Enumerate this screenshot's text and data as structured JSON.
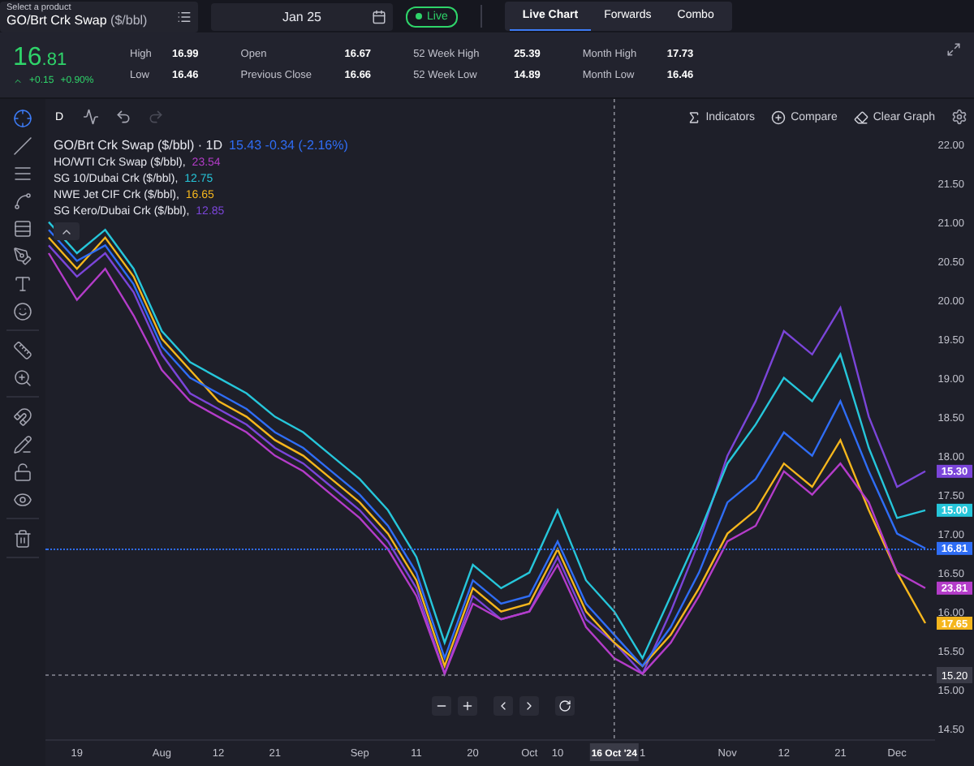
{
  "top_bar": {
    "product": {
      "hint": "Select a product",
      "name": "GO/Brt Crk Swap",
      "unit": "($/bbl)"
    },
    "date": "Jan 25",
    "live": "Live",
    "tabs": [
      {
        "label": "Live Chart",
        "selected": true
      },
      {
        "label": "Forwards",
        "selected": false
      },
      {
        "label": "Combo",
        "selected": false
      }
    ]
  },
  "quote": {
    "price": "16.81",
    "change": "+0.15",
    "change_pct": "+0.90%",
    "stats": [
      [
        {
          "label": "High",
          "value": "16.99"
        },
        {
          "label": "Low",
          "value": "16.46"
        }
      ],
      [
        {
          "label": "Open",
          "value": "16.67"
        },
        {
          "label": "Previous Close",
          "value": "16.66"
        }
      ],
      [
        {
          "label": "52 Week High",
          "value": "25.39"
        },
        {
          "label": "52 Week Low",
          "value": "14.89"
        }
      ],
      [
        {
          "label": "Month High",
          "value": "17.73"
        },
        {
          "label": "Month Low",
          "value": "16.46"
        }
      ]
    ]
  },
  "tool_groups": [
    [
      {
        "kind": "crosshair",
        "selected": true
      },
      {
        "kind": "line",
        "selected": false
      },
      {
        "kind": "channels",
        "selected": false
      },
      {
        "kind": "pattern",
        "selected": false
      },
      {
        "kind": "levels",
        "selected": false
      },
      {
        "kind": "brush",
        "selected": false
      },
      {
        "kind": "text",
        "selected": false
      },
      {
        "kind": "emoji",
        "selected": false
      }
    ],
    [
      {
        "kind": "ruler",
        "selected": false
      },
      {
        "kind": "zoom",
        "selected": false
      }
    ],
    [
      {
        "kind": "magnet",
        "selected": false
      },
      {
        "kind": "lock-drawing",
        "selected": false
      },
      {
        "kind": "unlock",
        "selected": false
      },
      {
        "kind": "hide",
        "selected": false
      }
    ],
    [
      {
        "kind": "delete",
        "selected": false
      }
    ]
  ],
  "chart_toolbar": {
    "interval": "D",
    "history": [
      {
        "kind": "undo",
        "disabled": false
      },
      {
        "kind": "redo",
        "disabled": true
      }
    ],
    "actions": [
      {
        "kind": "indicators",
        "label": "Indicators"
      },
      {
        "kind": "compare",
        "label": "Compare"
      },
      {
        "kind": "clear",
        "label": "Clear Graph"
      }
    ]
  },
  "legend": [
    {
      "suffix": " · 1D",
      "value": "15.43 -0.34 (-2.16%)"
    },
    {
      "suffix": ",",
      "value": "23.54"
    },
    {
      "suffix": ",",
      "value": "12.75"
    },
    {
      "suffix": ",",
      "value": "16.65"
    },
    {
      "suffix": ",",
      "value": "12.85"
    }
  ],
  "price_tags": [
    {
      "text": "15.30",
      "color": "#7b45d9"
    },
    {
      "text": "15.00",
      "color": "#26c6da"
    },
    {
      "text": "16.81",
      "color": "#2f6df5"
    },
    {
      "text": "23.81",
      "color": "#b43cc9"
    },
    {
      "text": "17.65",
      "color": "#f5b61d"
    }
  ],
  "crosshair": {
    "price": "15.20",
    "date": "16 Oct '24"
  },
  "nav_buttons": [
    {
      "kind": "zoom-out"
    },
    {
      "kind": "zoom-in"
    },
    {
      "kind": "left"
    },
    {
      "kind": "right"
    },
    {
      "kind": "reset"
    }
  ],
  "chart_data": {
    "type": "line",
    "categories": [
      null,
      "19",
      null,
      null,
      "Aug",
      null,
      "12",
      null,
      "21",
      null,
      null,
      "Sep",
      null,
      "11",
      null,
      "20",
      null,
      "Oct",
      "10",
      null,
      null,
      "1",
      null,
      null,
      "Nov",
      null,
      "12",
      null,
      "21",
      null,
      "Dec",
      null
    ],
    "ylim": [
      14.35,
      22.58
    ],
    "yticks": [
      {
        "value": 14.5,
        "label": "14.50"
      },
      {
        "value": 15,
        "label": "15.00"
      },
      {
        "value": 15.5,
        "label": "15.50"
      },
      {
        "value": 16,
        "label": "16.00"
      },
      {
        "value": 16.5,
        "label": "16.50"
      },
      {
        "value": 17,
        "label": "17.00"
      },
      {
        "value": 17.5,
        "label": "17.50"
      },
      {
        "value": 18,
        "label": "18.00"
      },
      {
        "value": 18.5,
        "label": "18.50"
      },
      {
        "value": 19,
        "label": "19.00"
      },
      {
        "value": 19.5,
        "label": "19.50"
      },
      {
        "value": 20,
        "label": "20.00"
      },
      {
        "value": 20.5,
        "label": "20.50"
      },
      {
        "value": 21,
        "label": "21.00"
      },
      {
        "value": 21.5,
        "label": "21.50"
      },
      {
        "value": 22,
        "label": "22.00"
      }
    ],
    "series": [
      {
        "name": "GO/Brt Crk Swap ($/bbl)",
        "color": "#2f6df5",
        "values": [
          20.9,
          20.5,
          20.7,
          20.2,
          19.4,
          19.0,
          18.8,
          18.6,
          18.3,
          18.1,
          17.8,
          17.5,
          17.1,
          16.5,
          15.4,
          16.4,
          16.1,
          16.2,
          16.9,
          16.1,
          15.7,
          15.3,
          15.8,
          16.5,
          17.4,
          17.7,
          18.3,
          18.0,
          18.7,
          17.8,
          17.0,
          16.81
        ]
      },
      {
        "name": "HO/WTI Crk Swap ($/bbl)",
        "color": "#b43cc9",
        "values": [
          20.6,
          20.0,
          20.4,
          19.8,
          19.1,
          18.7,
          18.5,
          18.3,
          18.0,
          17.8,
          17.5,
          17.2,
          16.8,
          16.2,
          15.2,
          16.1,
          15.9,
          16.0,
          16.6,
          15.8,
          15.4,
          15.2,
          15.6,
          16.2,
          16.9,
          17.1,
          17.8,
          17.5,
          17.9,
          17.4,
          16.5,
          16.3
        ]
      },
      {
        "name": "SG 10/Dubai Crk ($/bbl)",
        "color": "#26c6da",
        "values": [
          21.0,
          20.6,
          20.9,
          20.4,
          19.6,
          19.2,
          19.0,
          18.8,
          18.5,
          18.3,
          18.0,
          17.7,
          17.3,
          16.7,
          15.6,
          16.6,
          16.3,
          16.5,
          17.3,
          16.4,
          16.0,
          15.4,
          16.2,
          17.0,
          17.9,
          18.4,
          19.0,
          18.7,
          19.3,
          18.1,
          17.2,
          17.3
        ]
      },
      {
        "name": "NWE Jet CIF Crk ($/bbl)",
        "color": "#f5b61d",
        "values": [
          20.8,
          20.4,
          20.8,
          20.3,
          19.5,
          19.1,
          18.7,
          18.5,
          18.2,
          18.0,
          17.7,
          17.4,
          17.0,
          16.4,
          15.3,
          16.3,
          16.0,
          16.1,
          16.8,
          16.0,
          15.6,
          15.3,
          15.7,
          16.3,
          17.0,
          17.3,
          17.9,
          17.6,
          18.2,
          17.3,
          16.5,
          15.85
        ]
      },
      {
        "name": "SG Kero/Dubai Crk ($/bbl)",
        "color": "#7b45d9",
        "values": [
          20.7,
          20.3,
          20.6,
          20.1,
          19.3,
          18.8,
          18.6,
          18.4,
          18.1,
          17.9,
          17.6,
          17.3,
          16.9,
          16.3,
          15.2,
          16.2,
          15.9,
          16.0,
          16.7,
          15.9,
          15.6,
          15.2,
          16.0,
          16.9,
          18.0,
          18.7,
          19.6,
          19.3,
          19.9,
          18.5,
          17.6,
          17.8
        ]
      }
    ]
  }
}
